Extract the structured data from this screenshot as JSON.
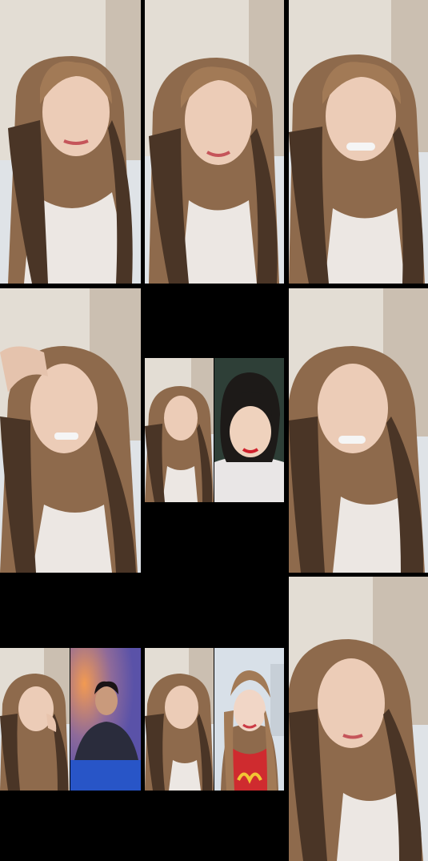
{
  "collage": {
    "background": "#000000",
    "tiles": [
      {
        "id": "1",
        "kind": "single",
        "scene": "room-curtain"
      },
      {
        "id": "2",
        "kind": "single",
        "scene": "room-curtain"
      },
      {
        "id": "3",
        "kind": "single",
        "scene": "room-curtain"
      },
      {
        "id": "4",
        "kind": "single",
        "scene": "room-curtain"
      },
      {
        "id": "5",
        "kind": "split",
        "left": "room-curtain",
        "right": "dark-green-wall"
      },
      {
        "id": "6",
        "kind": "single",
        "scene": "room-curtain"
      },
      {
        "id": "7",
        "kind": "split",
        "left": "room-curtain",
        "right": "purple-gradient-blue-table"
      },
      {
        "id": "8",
        "kind": "split",
        "left": "room-curtain",
        "right": "light-room-red-top"
      },
      {
        "id": "9",
        "kind": "single",
        "scene": "room-curtain"
      }
    ]
  },
  "colors": {
    "wall": "#e3ddd4",
    "curtain": "#cbbfb1",
    "couch": "#dfe3e7",
    "hair_light": "#a27a56",
    "hair_dark": "#4a3526",
    "skin": "#ecccb7",
    "top": "#ece7e3",
    "green_wall": "#2e3f37",
    "purple": "#6a58a6",
    "orange_glow": "#e38b54",
    "blue_table": "#2855c7",
    "red_top": "#cf2b2f",
    "yellow": "#f2c534",
    "light_room": "#d8e0e8"
  }
}
